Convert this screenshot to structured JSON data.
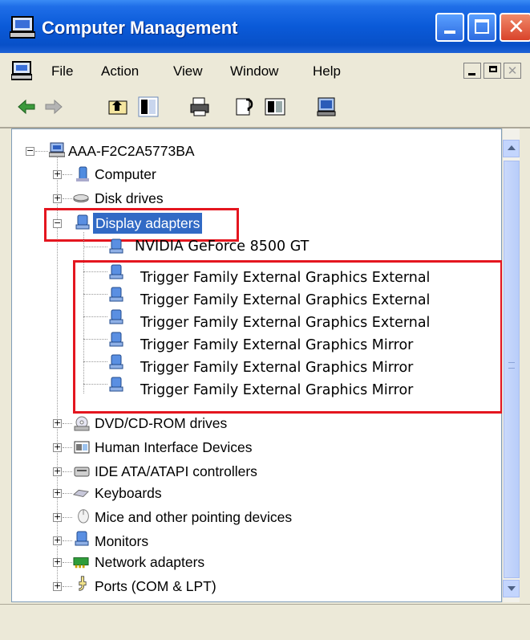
{
  "window": {
    "title": "Computer Management"
  },
  "menu": [
    "File",
    "Action",
    "View",
    "Window",
    "Help"
  ],
  "toolbar": {
    "icons": [
      "back-icon",
      "forward-icon",
      "up-folder-icon",
      "show-hide-tree-icon",
      "print-icon",
      "properties-icon",
      "help-icon",
      "scan-hardware-icon"
    ]
  },
  "tree": {
    "root": "AAA-F2C2A5773BA",
    "categories_top": [
      "Computer",
      "Disk drives"
    ],
    "display": {
      "label": "Display adapters",
      "children": [
        "NVIDIA GeForce 8500 GT",
        "Trigger Family External Graphics External",
        "Trigger Family External Graphics External",
        "Trigger Family External Graphics External",
        "Trigger Family External Graphics Mirror",
        "Trigger Family External Graphics Mirror",
        "Trigger Family External Graphics Mirror"
      ]
    },
    "categories_bottom": [
      "DVD/CD-ROM drives",
      "Human Interface Devices",
      "IDE ATA/ATAPI controllers",
      "Keyboards",
      "Mice and other pointing devices",
      "Monitors",
      "Network adapters",
      "Ports (COM & LPT)"
    ]
  },
  "colors": {
    "title_blue": "#0a5ad8",
    "selection": "#316ac5",
    "highlight_red": "#e4161f"
  }
}
